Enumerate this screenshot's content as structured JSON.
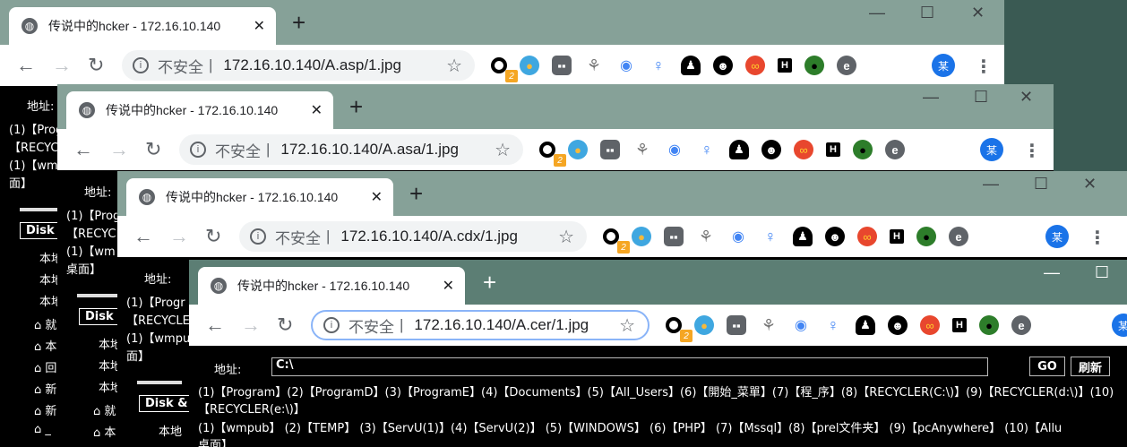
{
  "tab_title": "传说中的hcker - 172.16.10.140",
  "not_secure": "不安全",
  "separator": "|",
  "urls": [
    "172.16.10.140/A.asp/1.jpg",
    "172.16.10.140/A.asa/1.jpg",
    "172.16.10.140/A.cdx/1.jpg",
    "172.16.10.140/A.cer/1.jpg"
  ],
  "avatar_text": "某",
  "badge": "2",
  "page": {
    "addr_label": "地址:",
    "addr_value": "C:\\",
    "go": "GO",
    "refresh": "刷新",
    "line1": "(1)【Program】(2)【ProgramD】(3)【ProgramE】(4)【Documents】(5)【All_Users】(6)【開始_菜單】(7)【程_序】(8)【RECYCLER(C:\\)】(9)【RECYCLER(d:\\)】(10)",
    "line2": "【RECYCLER(e:\\)】",
    "line3": "(1)【wmpub】 (2)【TEMP】   (3)【ServU(1)】(4)【ServU(2)】 (5)【WINDOWS】  (6)【PHP】      (7)【Mssql】(8)【prel文件夹】   (9)【pcAnywhere】 (10)【Allu",
    "line4": "桌面】",
    "w1_l1": "(1)【Prog",
    "w1_l2": "【RECYCLE",
    "w1_l3": "(1)【wm",
    "w1_l4": "面】",
    "w2_l1": "(1)【Prog",
    "w2_l2": "【RECYC",
    "w2_l3": "(1)【wm",
    "w2_l4": "桌面】",
    "w3_l1": "(1)【Progr",
    "w3_l2": "【RECYCLE",
    "w3_l3": "(1)【wmpu",
    "w3_l4": "面】",
    "disk_short": "Disk",
    "disk_amp": "Disk &",
    "local": "本地",
    "local_short": "本",
    "folder_items": [
      "就",
      "本",
      "回",
      "新",
      "新",
      "_",
      "本"
    ]
  }
}
